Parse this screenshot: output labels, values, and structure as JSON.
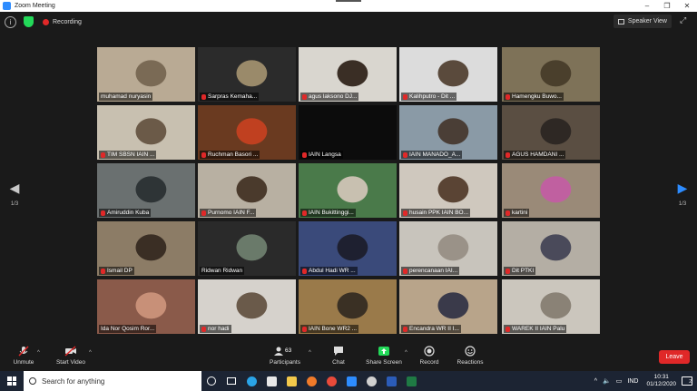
{
  "window": {
    "title": "Zoom Meeting"
  },
  "topbar": {
    "recording_label": "Recording",
    "speaker_view_label": "Speaker View"
  },
  "pager": {
    "left": "1/3",
    "right": "1/3"
  },
  "participants": [
    {
      "name": "muhamad nuryasin",
      "muted": false,
      "bg": "#b9aa94",
      "fg": "#7a6a55"
    },
    {
      "name": "Sarpras Kemaha...",
      "muted": true,
      "bg": "#2b2b2b",
      "fg": "#9a8a6a"
    },
    {
      "name": "agus laksono DJ...",
      "muted": true,
      "bg": "#d9d6cf",
      "fg": "#3a2e25"
    },
    {
      "name": "Kalihputro - Dit ...",
      "muted": true,
      "bg": "#dcdcdc",
      "fg": "#5a4a3c"
    },
    {
      "name": "Hamengku Buwo...",
      "muted": true,
      "bg": "#7e7258",
      "fg": "#4a3f2c"
    },
    {
      "name": "TIM SBSN IAIN ...",
      "muted": true,
      "bg": "#c8c0b0",
      "fg": "#6b5a48"
    },
    {
      "name": "Ruchman Basori ...",
      "muted": true,
      "bg": "#6a3a20",
      "fg": "#c04020"
    },
    {
      "name": "IAIN Langsa",
      "muted": true,
      "bg": "#0c0c0c",
      "fg": "#0c0c0c"
    },
    {
      "name": "IAIN MANADO_A...",
      "muted": true,
      "bg": "#8a9aa6",
      "fg": "#4a3e36"
    },
    {
      "name": "AGUS HAMDANI ...",
      "muted": true,
      "bg": "#5a4e42",
      "fg": "#2e2824"
    },
    {
      "name": "Amiruddin Kuba",
      "muted": true,
      "bg": "#6a7070",
      "fg": "#2e3436"
    },
    {
      "name": "Purnomo IAIN F...",
      "muted": true,
      "bg": "#b8b0a2",
      "fg": "#4a3a2c"
    },
    {
      "name": "IAIN Bukittinggi...",
      "muted": true,
      "bg": "#4a7a4a",
      "fg": "#c8c0b0"
    },
    {
      "name": "husain PPK IAIN BO...",
      "muted": true,
      "bg": "#cfc8be",
      "fg": "#5a4434"
    },
    {
      "name": "kartini",
      "muted": true,
      "bg": "#9a8a78",
      "fg": "#c060a0"
    },
    {
      "name": "Ismail  DP",
      "muted": true,
      "bg": "#8c7c66",
      "fg": "#3a2e24"
    },
    {
      "name": "Ridwan Ridwan",
      "muted": false,
      "bg": "#2a2a2a",
      "fg": "#6a7a6a"
    },
    {
      "name": "Abdul Hadi WR ...",
      "muted": true,
      "bg": "#3a4a7a",
      "fg": "#1e2030"
    },
    {
      "name": "perencanaan IAI...",
      "muted": true,
      "bg": "#c8c4bc",
      "fg": "#9a9288"
    },
    {
      "name": "Dit PTKI",
      "muted": true,
      "bg": "#b4aea4",
      "fg": "#4a4a5a"
    },
    {
      "name": "Ida Nor Qosim Ror...",
      "muted": false,
      "bg": "#8a5a4a",
      "fg": "#c89078"
    },
    {
      "name": "nor hadi",
      "muted": true,
      "bg": "#d6d2cc",
      "fg": "#6a5a4a"
    },
    {
      "name": "IAIN Bone WR2 ...",
      "muted": true,
      "bg": "#9a7a4a",
      "fg": "#3a3024"
    },
    {
      "name": "Encandra WR II I...",
      "muted": true,
      "bg": "#b8a48a",
      "fg": "#3a3a4a"
    },
    {
      "name": "WAREK II IAIN Palu",
      "muted": true,
      "bg": "#cbc6bd",
      "fg": "#8a8276"
    }
  ],
  "toolbar": {
    "unmute": "Unmute",
    "start_video": "Start Video",
    "participants_label": "Participants",
    "participants_count": "63",
    "chat": "Chat",
    "share_screen": "Share Screen",
    "record": "Record",
    "reactions": "Reactions",
    "leave": "Leave"
  },
  "taskbar": {
    "search_placeholder": "Search for anything",
    "lang": "IND",
    "time": "10:31",
    "date": "01/12/2020",
    "notifications": "2"
  },
  "colors": {
    "accent": "#2d8cff",
    "share_green": "#23d959",
    "leave_red": "#e02828",
    "active_speaker": "#c8e84a"
  }
}
